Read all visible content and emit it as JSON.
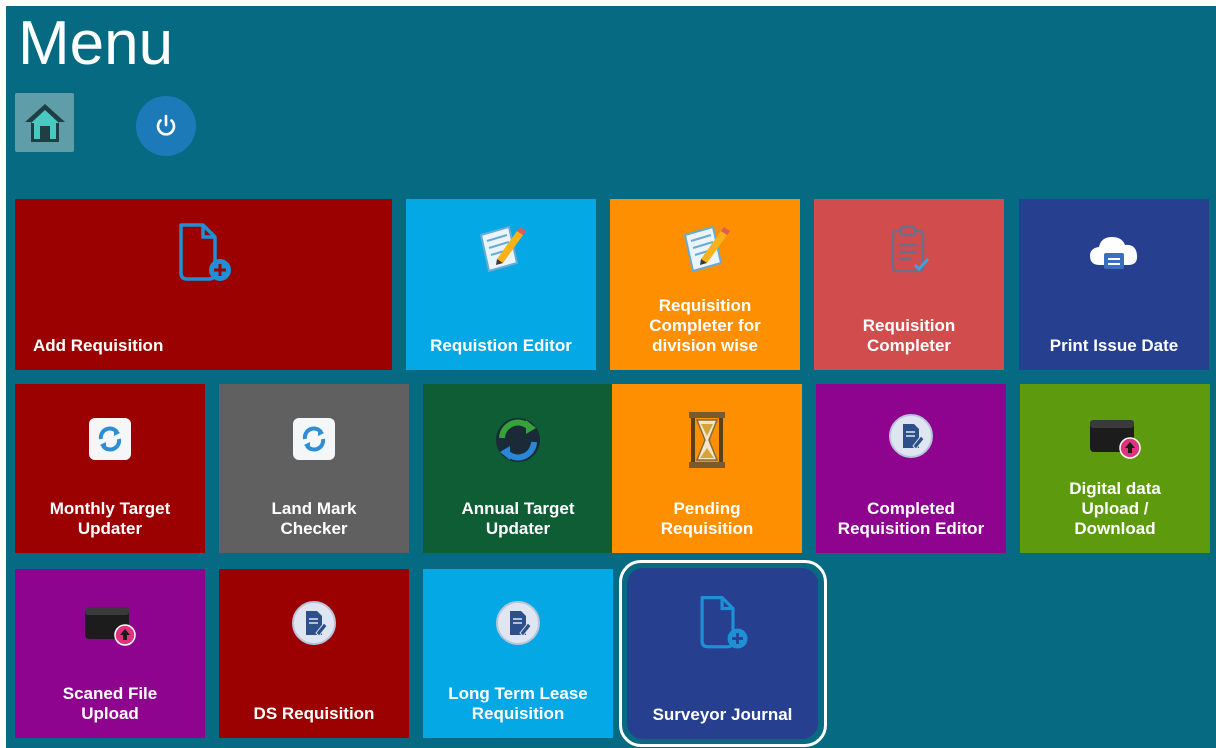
{
  "header": {
    "title": "Menu"
  },
  "nav": {
    "home_icon": "home-icon",
    "power_icon": "power-icon"
  },
  "tiles": {
    "add_requisition": {
      "label": "Add Requisition",
      "color": "#9b0101"
    },
    "requisition_editor": {
      "label": "Requistion Editor",
      "color": "#03a8e5"
    },
    "requisition_completer_division": {
      "label": "Requisition\nCompleter for\ndivision wise",
      "color": "#fd8f00"
    },
    "requisition_completer": {
      "label": "Requisition\nCompleter",
      "color": "#d14c4c"
    },
    "print_issue_date": {
      "label": "Print Issue Date",
      "color": "#263f8f"
    },
    "monthly_target_updater": {
      "label": "Monthly Target\nUpdater",
      "color": "#9b0101"
    },
    "land_mark_checker": {
      "label": "Land Mark\nChecker",
      "color": "#606060"
    },
    "annual_target_updater": {
      "label": "Annual Target\nUpdater",
      "color": "#0f5d34"
    },
    "pending_requisition": {
      "label": "Pending\nRequisition",
      "color": "#fd8f00"
    },
    "completed_requisition_editor": {
      "label": "Completed\nRequisition Editor",
      "color": "#8f048f"
    },
    "digital_data_upload": {
      "label": "Digital data\nUpload /\nDownload",
      "color": "#5d9a0e"
    },
    "scaned_file_upload": {
      "label": "Scaned File\nUpload",
      "color": "#8f048f"
    },
    "ds_requisition": {
      "label": "DS Requisition",
      "color": "#9b0101"
    },
    "long_term_lease_requisition": {
      "label": "Long Term Lease\nRequisition",
      "color": "#03a8e5"
    },
    "surveyor_journal": {
      "label": "Surveyor Journal",
      "color": "#263f8f"
    }
  },
  "theme": {
    "background": "#066b82",
    "text": "#ffffff"
  }
}
